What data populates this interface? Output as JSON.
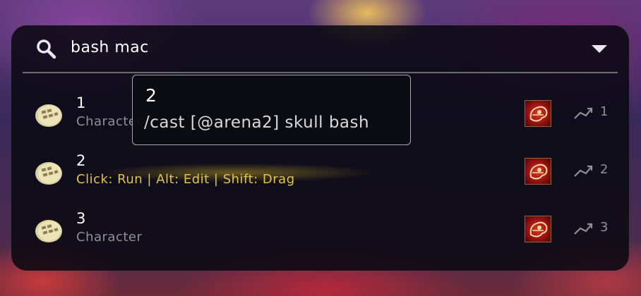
{
  "search": {
    "query": "bash mac"
  },
  "rows": [
    {
      "name": "1",
      "subtitle": "Character",
      "keybind": "1",
      "icon": "macro-icon"
    },
    {
      "name": "2",
      "subtitle": "Click: Run | Alt: Edit | Shift: Drag",
      "keybind": "2",
      "icon": "macro-icon"
    },
    {
      "name": "3",
      "subtitle": "Character",
      "keybind": "3",
      "icon": "macro-icon"
    }
  ],
  "tooltip": {
    "title": "2",
    "body": "/cast [@arena2] skull bash"
  },
  "colors": {
    "hint": "#e3c44a",
    "muted": "#8f8f98",
    "panel": "#08080f"
  }
}
